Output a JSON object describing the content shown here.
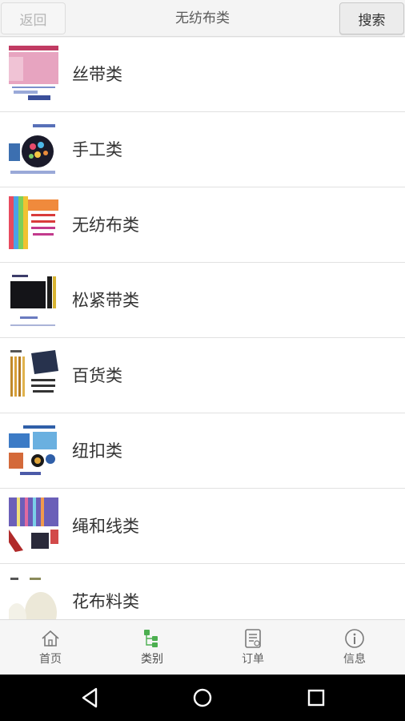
{
  "header": {
    "back_label": "返回",
    "title": "无纺布类",
    "search_label": "搜索"
  },
  "categories": [
    {
      "label": "丝带类",
      "icon": "ribbon-thumbnail"
    },
    {
      "label": "手工类",
      "icon": "handcraft-thumbnail"
    },
    {
      "label": "无纺布类",
      "icon": "nonwoven-fabric-thumbnail"
    },
    {
      "label": "松紧带类",
      "icon": "elastic-band-thumbnail"
    },
    {
      "label": "百货类",
      "icon": "general-goods-thumbnail"
    },
    {
      "label": "纽扣类",
      "icon": "buttons-thumbnail"
    },
    {
      "label": "绳和线类",
      "icon": "rope-thread-thumbnail"
    },
    {
      "label": "花布料类",
      "icon": "floral-fabric-thumbnail"
    }
  ],
  "tabs": [
    {
      "label": "首页",
      "icon": "home-icon"
    },
    {
      "label": "类别",
      "icon": "category-icon",
      "active": true
    },
    {
      "label": "订单",
      "icon": "order-icon"
    },
    {
      "label": "信息",
      "icon": "info-icon"
    }
  ],
  "colors": {
    "accent": "#4caf50",
    "text": "#333333",
    "header_bg": "#f4f4f4"
  }
}
